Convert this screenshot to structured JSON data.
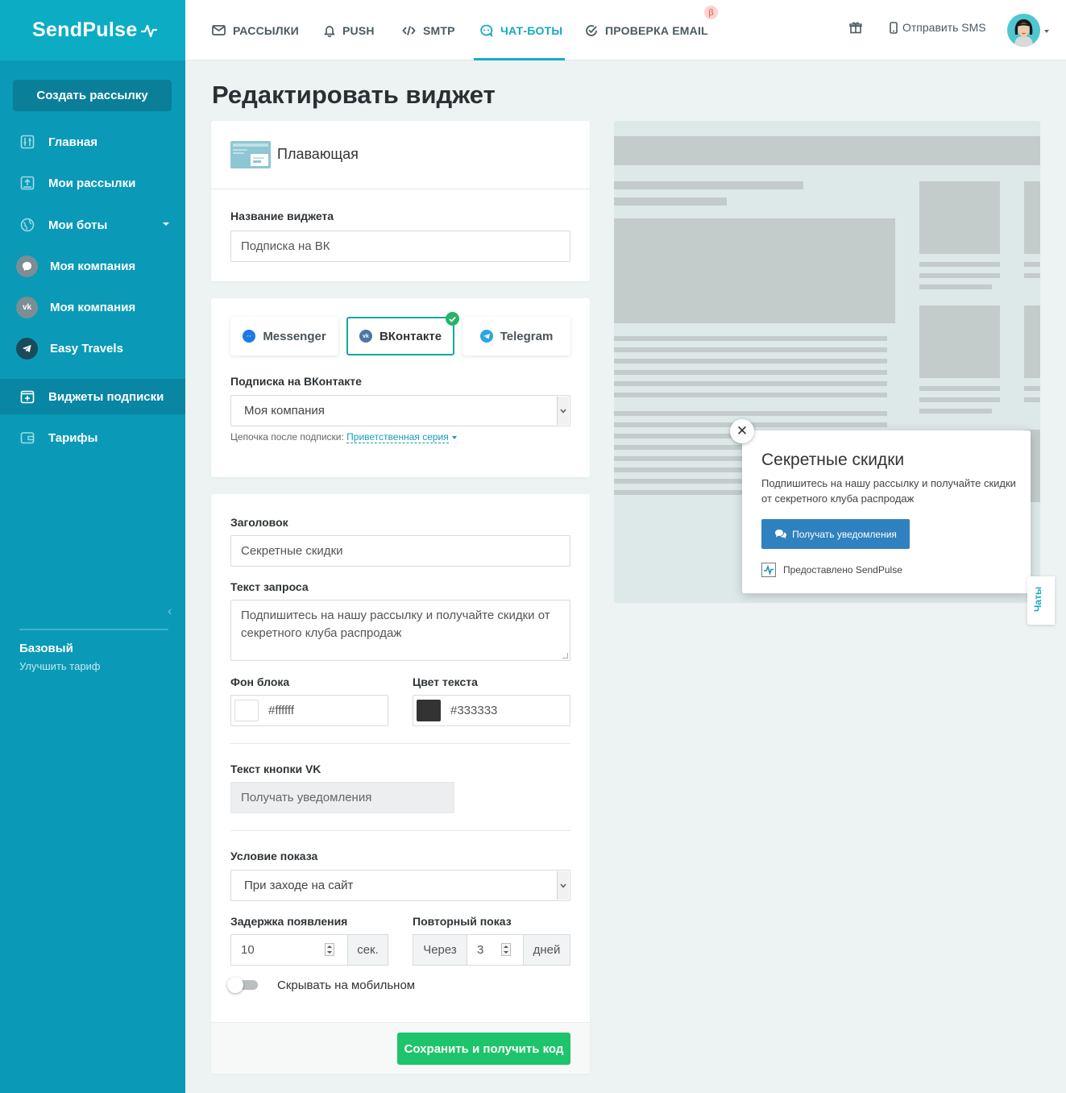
{
  "brand": {
    "logo_text": "SendPulse"
  },
  "sidebar": {
    "create_button": "Создать рассылку",
    "items": [
      {
        "label": "Главная",
        "icon": "sliders-icon"
      },
      {
        "label": "Мои рассылки",
        "icon": "upload-box-icon"
      },
      {
        "label": "Мои боты",
        "icon": "globe-icon"
      },
      {
        "label": "Моя компания",
        "icon": "messenger-icon"
      },
      {
        "label": "Моя компания",
        "icon": "vk-icon"
      },
      {
        "label": "Easy Travels",
        "icon": "telegram-icon"
      },
      {
        "label": "Виджеты подписки",
        "icon": "plus-box-icon",
        "active": true
      },
      {
        "label": "Тарифы",
        "icon": "wallet-icon"
      }
    ],
    "plan": {
      "name": "Базовый",
      "upgrade": "Улучшить тариф"
    }
  },
  "topnav": {
    "tabs": [
      {
        "label": "РАССЫЛКИ",
        "icon": "envelope-icon"
      },
      {
        "label": "PUSH",
        "icon": "bell-icon"
      },
      {
        "label": "SMTP",
        "icon": "code-icon"
      },
      {
        "label": "ЧАТ-БОТЫ",
        "icon": "chat-bot-icon",
        "active": true
      },
      {
        "label": "ПРОВЕРКА EMAIL",
        "icon": "check-circle-icon"
      }
    ],
    "beta_badge": "β",
    "send_sms": "Отправить SMS"
  },
  "page": {
    "title": "Редактировать виджет"
  },
  "widget_type": {
    "label": "Плавающая"
  },
  "widget_name": {
    "label": "Название виджета",
    "value": "Подписка на ВК"
  },
  "channels": {
    "options": [
      {
        "label": "Messenger",
        "color": "#1b7ae6"
      },
      {
        "label": "ВКонтакте",
        "color": "#4a76a8",
        "selected": true
      },
      {
        "label": "Telegram",
        "color": "#2ca5e0"
      }
    ],
    "subscription_label": "Подписка на ВКонтакте",
    "subscription_value": "Моя компания",
    "chain_label": "Цепочка после подписки:",
    "chain_value": "Приветственная серия"
  },
  "form": {
    "heading_label": "Заголовок",
    "heading_value": "Секретные скидки",
    "request_label": "Текст запроса",
    "request_value": "Подпишитесь на нашу рассылку и получайте скидки от секретного клуба распродаж",
    "bg_label": "Фон блока",
    "bg_value": "#ffffff",
    "text_color_label": "Цвет текста",
    "text_color_value": "#333333",
    "button_text_label": "Текст кнопки VK",
    "button_text_value": "Получать уведомления",
    "condition_label": "Условие показа",
    "condition_value": "При заходе на сайт",
    "delay_label": "Задержка появления",
    "delay_value": "10",
    "delay_unit": "сек.",
    "repeat_label": "Повторный показ",
    "repeat_prefix": "Через",
    "repeat_value": "3",
    "repeat_unit": "дней",
    "hide_mobile_label": "Скрывать на мобильном",
    "hide_mobile": false,
    "save_button": "Сохранить и получить код"
  },
  "preview": {
    "close": "✕",
    "title": "Секретные скидки",
    "text": "Подпишитесь на нашу рассылку и получайте скидки от секретного клуба распродаж",
    "button": "Получать уведомления",
    "branding": "Предоставлено SendPulse",
    "chats_tab": "Чаты"
  }
}
